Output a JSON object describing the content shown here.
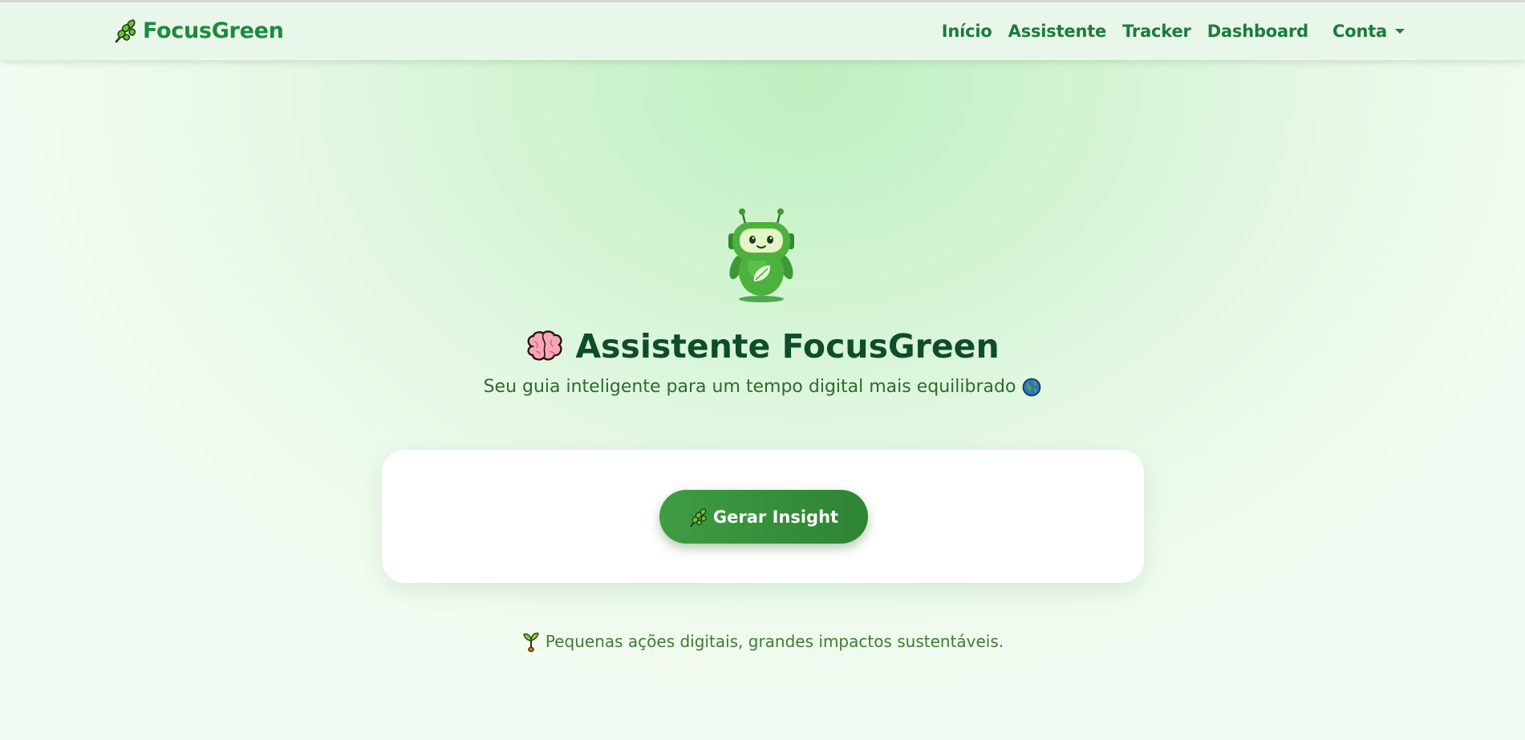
{
  "navbar": {
    "brand": "FocusGreen",
    "brand_icon": "leaf-icon",
    "links": [
      "Início",
      "Assistente",
      "Tracker",
      "Dashboard"
    ],
    "account": "Conta"
  },
  "hero": {
    "title": "Assistente FocusGreen",
    "title_icon": "brain-icon",
    "subtitle": "Seu guia inteligente para um tempo digital mais equilibrado",
    "subtitle_icon": "globe-icon",
    "mascot": "robot-mascot-icon"
  },
  "card": {
    "button_label": "Gerar Insight",
    "button_icon": "leaf-icon"
  },
  "footer": {
    "tagline": "Pequenas ações digitais, grandes impactos sustentáveis.",
    "tagline_icon": "sprout-icon"
  },
  "colors": {
    "brand": "#1c8a3d",
    "title": "#0f4d2a",
    "button": "#3e9c43",
    "background": "#c8f2c9"
  }
}
